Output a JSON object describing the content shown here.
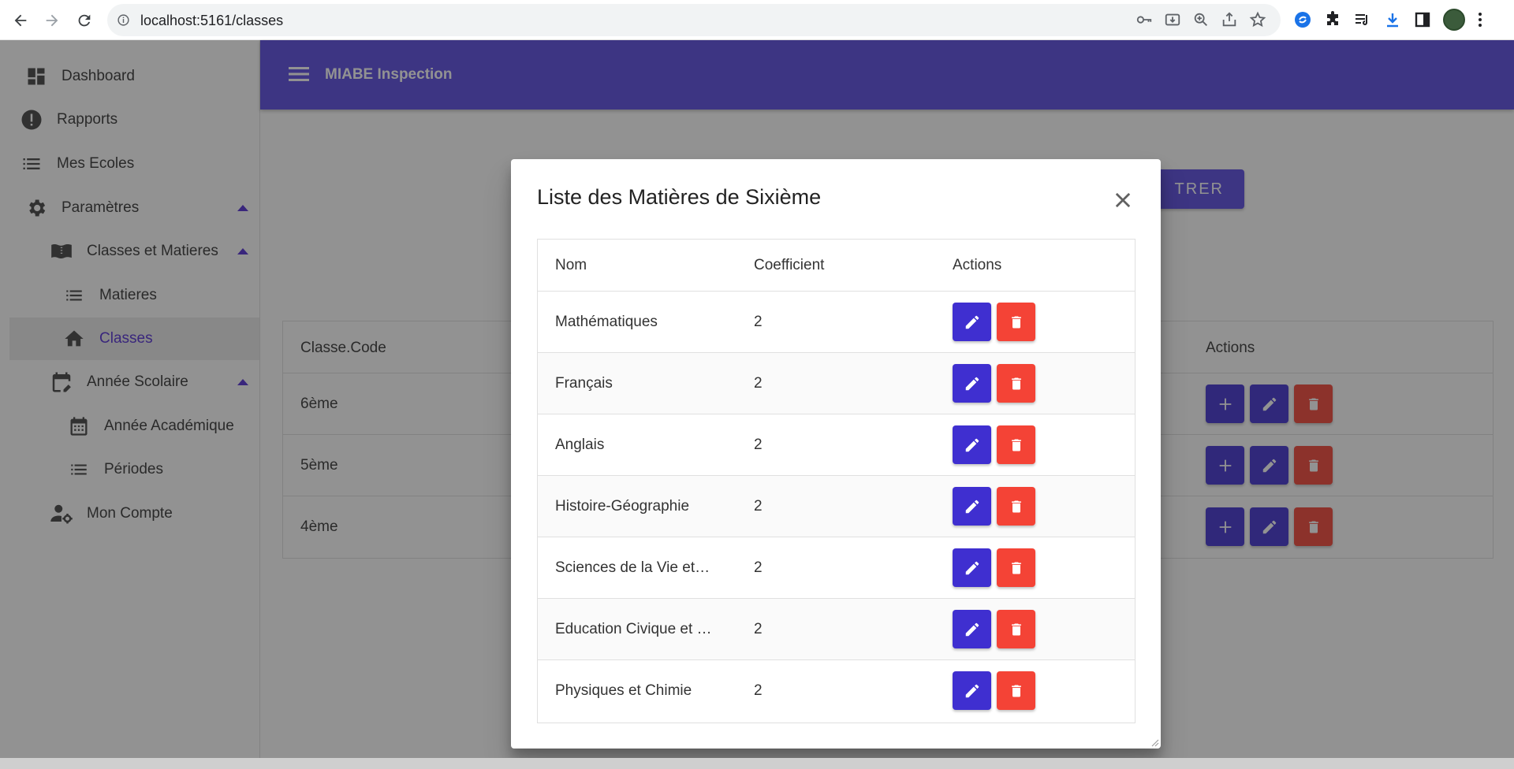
{
  "browser": {
    "url": "localhost:5161/classes"
  },
  "sidebar": {
    "items": [
      {
        "label": "Dashboard"
      },
      {
        "label": "Rapports"
      },
      {
        "label": "Mes Ecoles"
      },
      {
        "label": "Paramètres"
      },
      {
        "label": "Classes et Matieres"
      },
      {
        "label": "Matieres"
      },
      {
        "label": "Classes"
      },
      {
        "label": "Année Scolaire"
      },
      {
        "label": "Année Académique"
      },
      {
        "label": "Périodes"
      },
      {
        "label": "Mon Compte"
      }
    ]
  },
  "topbar": {
    "title": "MIABE Inspection"
  },
  "page": {
    "register_button": "TRER",
    "table": {
      "headers": [
        "Classe.Code",
        "Actions"
      ],
      "rows": [
        {
          "code": "6ème"
        },
        {
          "code": "5ème"
        },
        {
          "code": "4ème"
        }
      ]
    }
  },
  "dialog": {
    "title": "Liste des Matières de Sixième",
    "headers": {
      "nom": "Nom",
      "coefficient": "Coefficient",
      "actions": "Actions"
    },
    "rows": [
      {
        "nom": "Mathématiques",
        "coefficient": "2"
      },
      {
        "nom": "Français",
        "coefficient": "2"
      },
      {
        "nom": "Anglais",
        "coefficient": "2"
      },
      {
        "nom": "Histoire-Géographie",
        "coefficient": "2"
      },
      {
        "nom": "Sciences de la Vie et…",
        "coefficient": "2"
      },
      {
        "nom": "Education Civique et …",
        "coefficient": "2"
      },
      {
        "nom": "Physiques et Chimie",
        "coefficient": "2"
      }
    ]
  },
  "colors": {
    "primary": "#594ae2",
    "action_blue": "#3f2fd0",
    "action_red": "#f44336",
    "active_text": "#512bd4"
  }
}
